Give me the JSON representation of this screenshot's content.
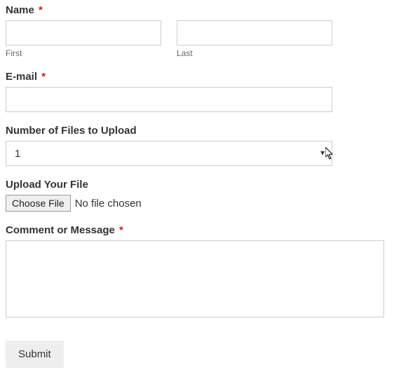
{
  "name": {
    "label": "Name",
    "required": "*",
    "first_sub": "First",
    "last_sub": "Last",
    "first_value": "",
    "last_value": ""
  },
  "email": {
    "label": "E-mail",
    "required": "*",
    "value": ""
  },
  "numfiles": {
    "label": "Number of Files to Upload",
    "selected": "1"
  },
  "upload": {
    "label": "Upload Your File",
    "button": "Choose File",
    "status": "No file chosen"
  },
  "comment": {
    "label": "Comment or Message",
    "required": "*",
    "value": ""
  },
  "submit": {
    "label": "Submit"
  }
}
